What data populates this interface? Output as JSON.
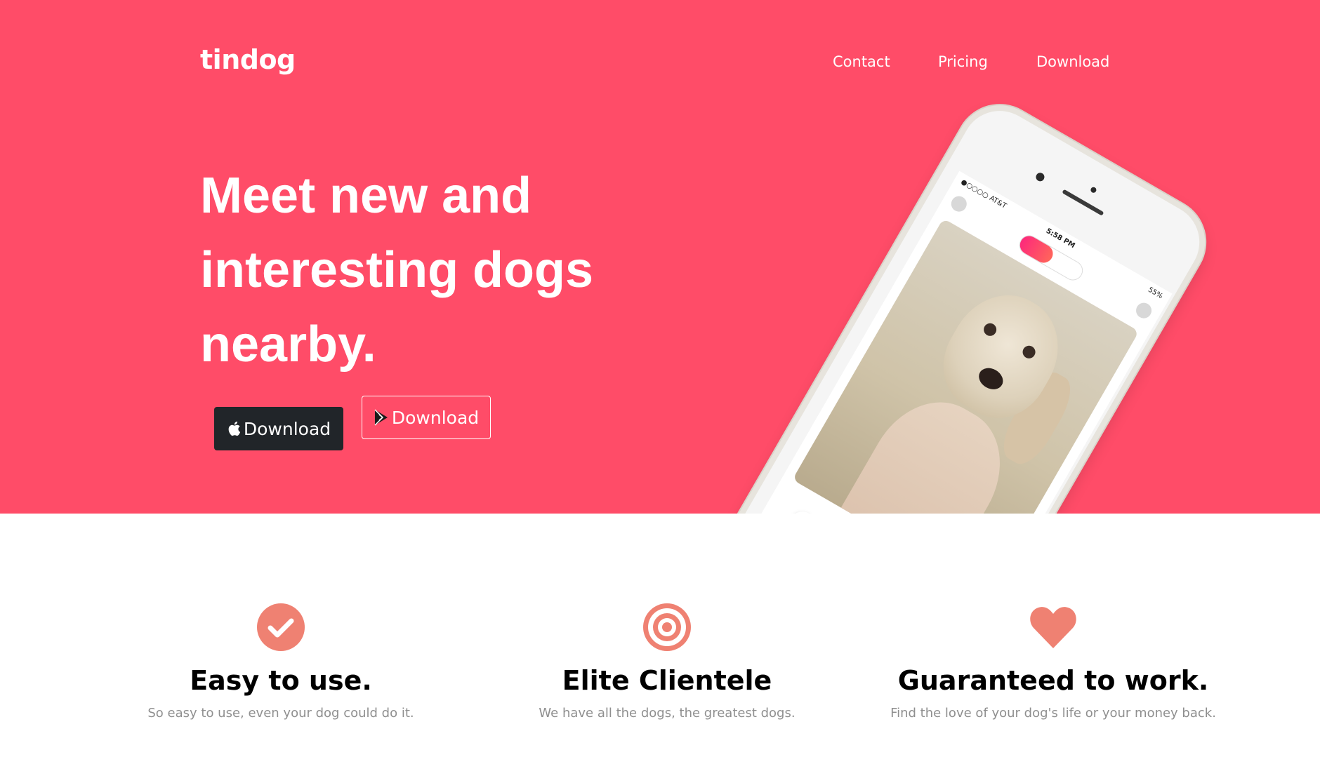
{
  "brand": {
    "name": "tindog"
  },
  "nav": {
    "items": [
      {
        "label": "Contact"
      },
      {
        "label": "Pricing"
      },
      {
        "label": "Download"
      }
    ]
  },
  "hero": {
    "headline": "Meet new and interesting dogs nearby.",
    "background_color": "#ff4c68",
    "buttons": {
      "apple": {
        "label": "Download",
        "icon": "apple-icon"
      },
      "google": {
        "label": "Download",
        "icon": "play-store-icon"
      }
    },
    "phone": {
      "carrier": "●○○○○ AT&T",
      "time": "5:58 PM",
      "battery": "55%"
    }
  },
  "features": {
    "icon_color": "#ef8172",
    "items": [
      {
        "icon": "check-circle-icon",
        "title": "Easy to use.",
        "text": "So easy to use, even your dog could do it."
      },
      {
        "icon": "bullseye-icon",
        "title": "Elite Clientele",
        "text": "We have all the dogs, the greatest dogs."
      },
      {
        "icon": "heart-icon",
        "title": "Guaranteed to work.",
        "text": "Find the love of your dog's life or your money back."
      }
    ]
  }
}
